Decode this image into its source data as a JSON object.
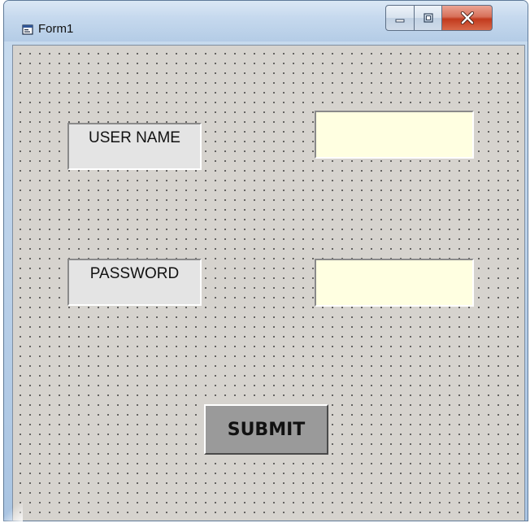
{
  "window": {
    "title": "Form1",
    "controls": {
      "minimize_icon": "minimize-icon",
      "maximize_icon": "maximize-icon",
      "close_icon": "close-icon"
    }
  },
  "form": {
    "username_label": "USER NAME",
    "username_value": "",
    "password_label": "PASSWORD",
    "password_value": "",
    "submit_label": "SUBMIT"
  },
  "colors": {
    "form_background": "#d6d3ce",
    "textbox_background": "#ffffe1",
    "label_background": "#e4e4e4",
    "button_background": "#9a9a9a",
    "close_button": "#c23a1d"
  }
}
